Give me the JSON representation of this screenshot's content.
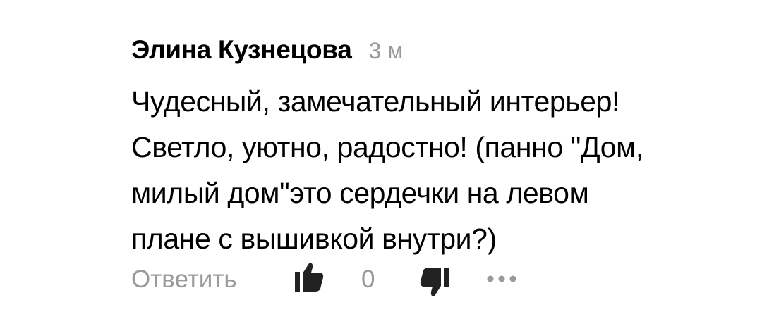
{
  "comment": {
    "author": "Элина Кузнецова",
    "time": "3 м",
    "text": "Чудесный, замечательный интерьер!\nСветло, уютно, радостно! (панно \"Дом,\nмилый дом\"это сердечки на левом\nплане с вышивкой внутри?)"
  },
  "actions": {
    "reply_label": "Ответить",
    "like_count": "0",
    "icons": {
      "like": "thumbs-up-icon",
      "dislike": "thumbs-down-icon",
      "more": "more-dots-icon"
    }
  },
  "colors": {
    "text": "#000000",
    "muted": "#9a9a9a",
    "icon": "#222222",
    "background": "#ffffff"
  }
}
